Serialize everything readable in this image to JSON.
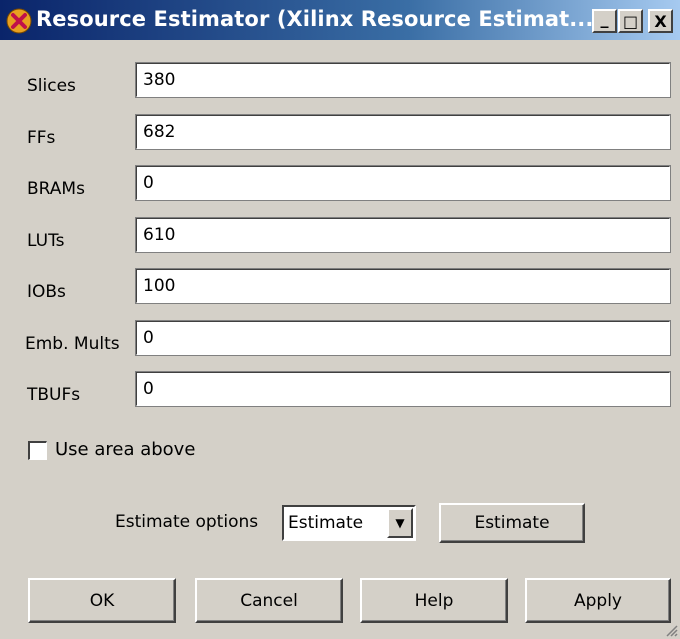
{
  "window": {
    "title": "Resource Estimator (Xilinx Resource Estimat...",
    "minimize_glyph": "_",
    "maximize_glyph": "□",
    "close_glyph": "X",
    "icon": "app-icon"
  },
  "fields": [
    {
      "label": "Slices",
      "value": "380"
    },
    {
      "label": "FFs",
      "value": "682"
    },
    {
      "label": "BRAMs",
      "value": "0"
    },
    {
      "label": "LUTs",
      "value": "610"
    },
    {
      "label": "IOBs",
      "value": "100"
    },
    {
      "label": "Emb. Mults",
      "value": "0"
    },
    {
      "label": "TBUFs",
      "value": "0"
    }
  ],
  "use_area": {
    "label": "Use area above",
    "checked": false
  },
  "estimate": {
    "options_label": "Estimate options",
    "selected_option": "Estimate",
    "button_label": "Estimate"
  },
  "buttons": {
    "ok": "OK",
    "cancel": "Cancel",
    "help": "Help",
    "apply": "Apply"
  }
}
